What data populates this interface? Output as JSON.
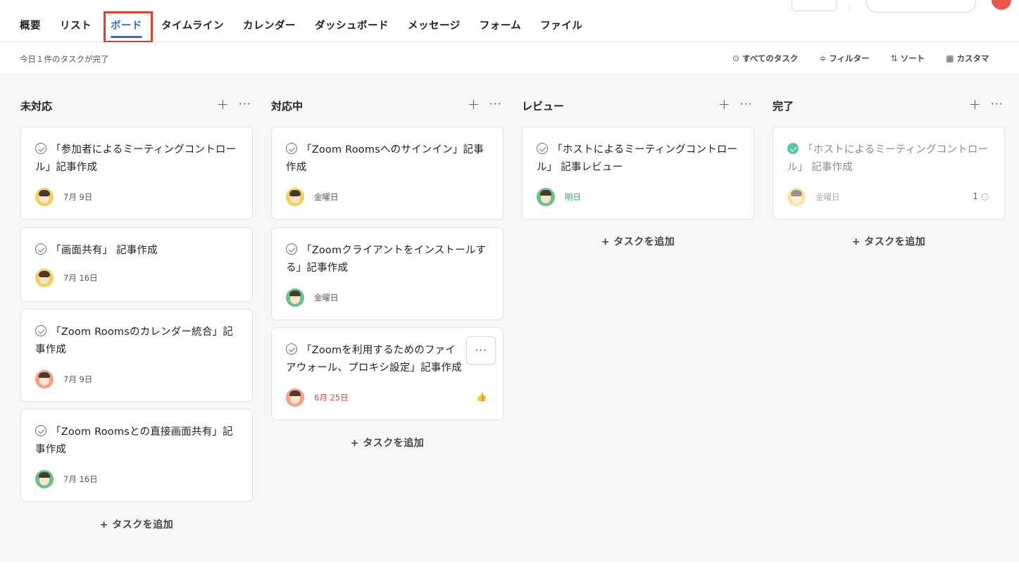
{
  "tabs": [
    {
      "label": "概要"
    },
    {
      "label": "リスト"
    },
    {
      "label": "ボード"
    },
    {
      "label": "タイムライン"
    },
    {
      "label": "カレンダー"
    },
    {
      "label": "ダッシュボード"
    },
    {
      "label": "メッセージ"
    },
    {
      "label": "フォーム"
    },
    {
      "label": "ファイル"
    }
  ],
  "active_tab": "ボード",
  "status_text": "今日１件のタスクが完了",
  "tools": [
    {
      "icon": "check-circle-icon",
      "glyph": "⊙",
      "label": "すべてのタスク"
    },
    {
      "icon": "filter-icon",
      "glyph": "≑",
      "label": "フィルター"
    },
    {
      "icon": "sort-icon",
      "glyph": "⇅",
      "label": "ソート"
    },
    {
      "icon": "customize-icon",
      "glyph": "▦",
      "label": "カスタマ"
    }
  ],
  "columns": [
    {
      "title": "未対応",
      "add_label": "+ タスクを追加",
      "cards": [
        {
          "title": "「参加者によるミーティングコントロール」記事作成",
          "date": "7月 9日",
          "avatar": "yellow"
        },
        {
          "title": "「画面共有」 記事作成",
          "date": "7月 16日",
          "avatar": "yellow"
        },
        {
          "title": "「Zoom Roomsのカレンダー統合」記事作成",
          "date": "7月 9日",
          "avatar": "peach"
        },
        {
          "title": "「Zoom Roomsとの直接画面共有」記事作成",
          "date": "7月 16日",
          "avatar": "green"
        }
      ]
    },
    {
      "title": "対応中",
      "add_label": "+ タスクを追加",
      "cards": [
        {
          "title": "「Zoom Roomsへのサインイン」記事作成",
          "date": "金曜日",
          "avatar": "yellow"
        },
        {
          "title": "「Zoomクライアントをインストールする」記事作成",
          "date": "金曜日",
          "avatar": "green"
        },
        {
          "title": "「Zoomを利用するためのファイアウォール、プロキシ設定」記事作成",
          "date": "6月 25日",
          "avatar": "peach",
          "more": "···",
          "like": "👍"
        }
      ]
    },
    {
      "title": "レビュー",
      "add_label": "+ タスクを追加",
      "cards": [
        {
          "title": "「ホストによるミーティングコントロール」 記事レビュー",
          "date": "明日",
          "avatar": "green"
        }
      ]
    },
    {
      "title": "完了",
      "add_label": "+ タスクを追加",
      "cards": [
        {
          "title": "「ホストによるミーティングコントロール」 記事作成",
          "date": "金曜日",
          "avatar": "yellow",
          "comments": "1"
        }
      ]
    }
  ],
  "colors": {
    "accent": "#2f6fd6",
    "highlight": "#e53e2f",
    "overdue": "#e0463b",
    "tomorrow": "#2da36e",
    "done": "#58c4a9"
  }
}
